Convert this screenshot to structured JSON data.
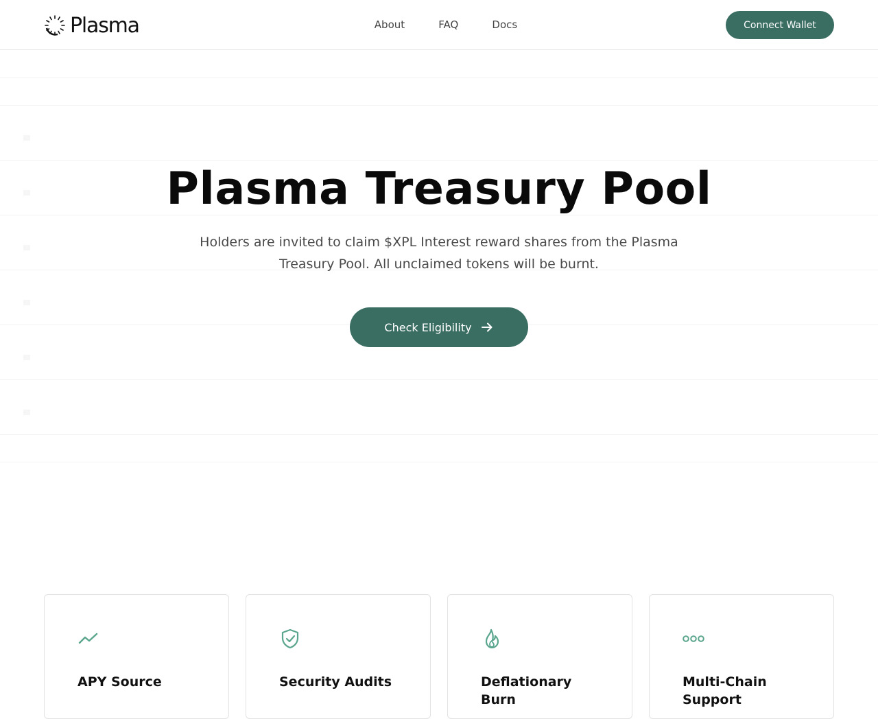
{
  "header": {
    "logo_text": "Plasma",
    "nav": [
      "About",
      "FAQ",
      "Docs"
    ],
    "connect_label": "Connect Wallet"
  },
  "hero": {
    "title": "Plasma Treasury Pool",
    "subtitle": "Holders are invited to claim $XPL Interest reward shares from the Plasma Treasury Pool. All unclaimed tokens will be burnt.",
    "cta_label": "Check Eligibility"
  },
  "cards": [
    {
      "icon": "trending-up-icon",
      "title": "APY Source"
    },
    {
      "icon": "shield-check-icon",
      "title": "Security Audits"
    },
    {
      "icon": "flame-icon",
      "title": "Deflationary Burn"
    },
    {
      "icon": "chain-links-icon",
      "title": "Multi-Chain Support"
    }
  ],
  "colors": {
    "accent": "#3b6e62",
    "icon": "#5aa58d",
    "text": "#0a0a0a",
    "muted": "#4a4a4a"
  }
}
